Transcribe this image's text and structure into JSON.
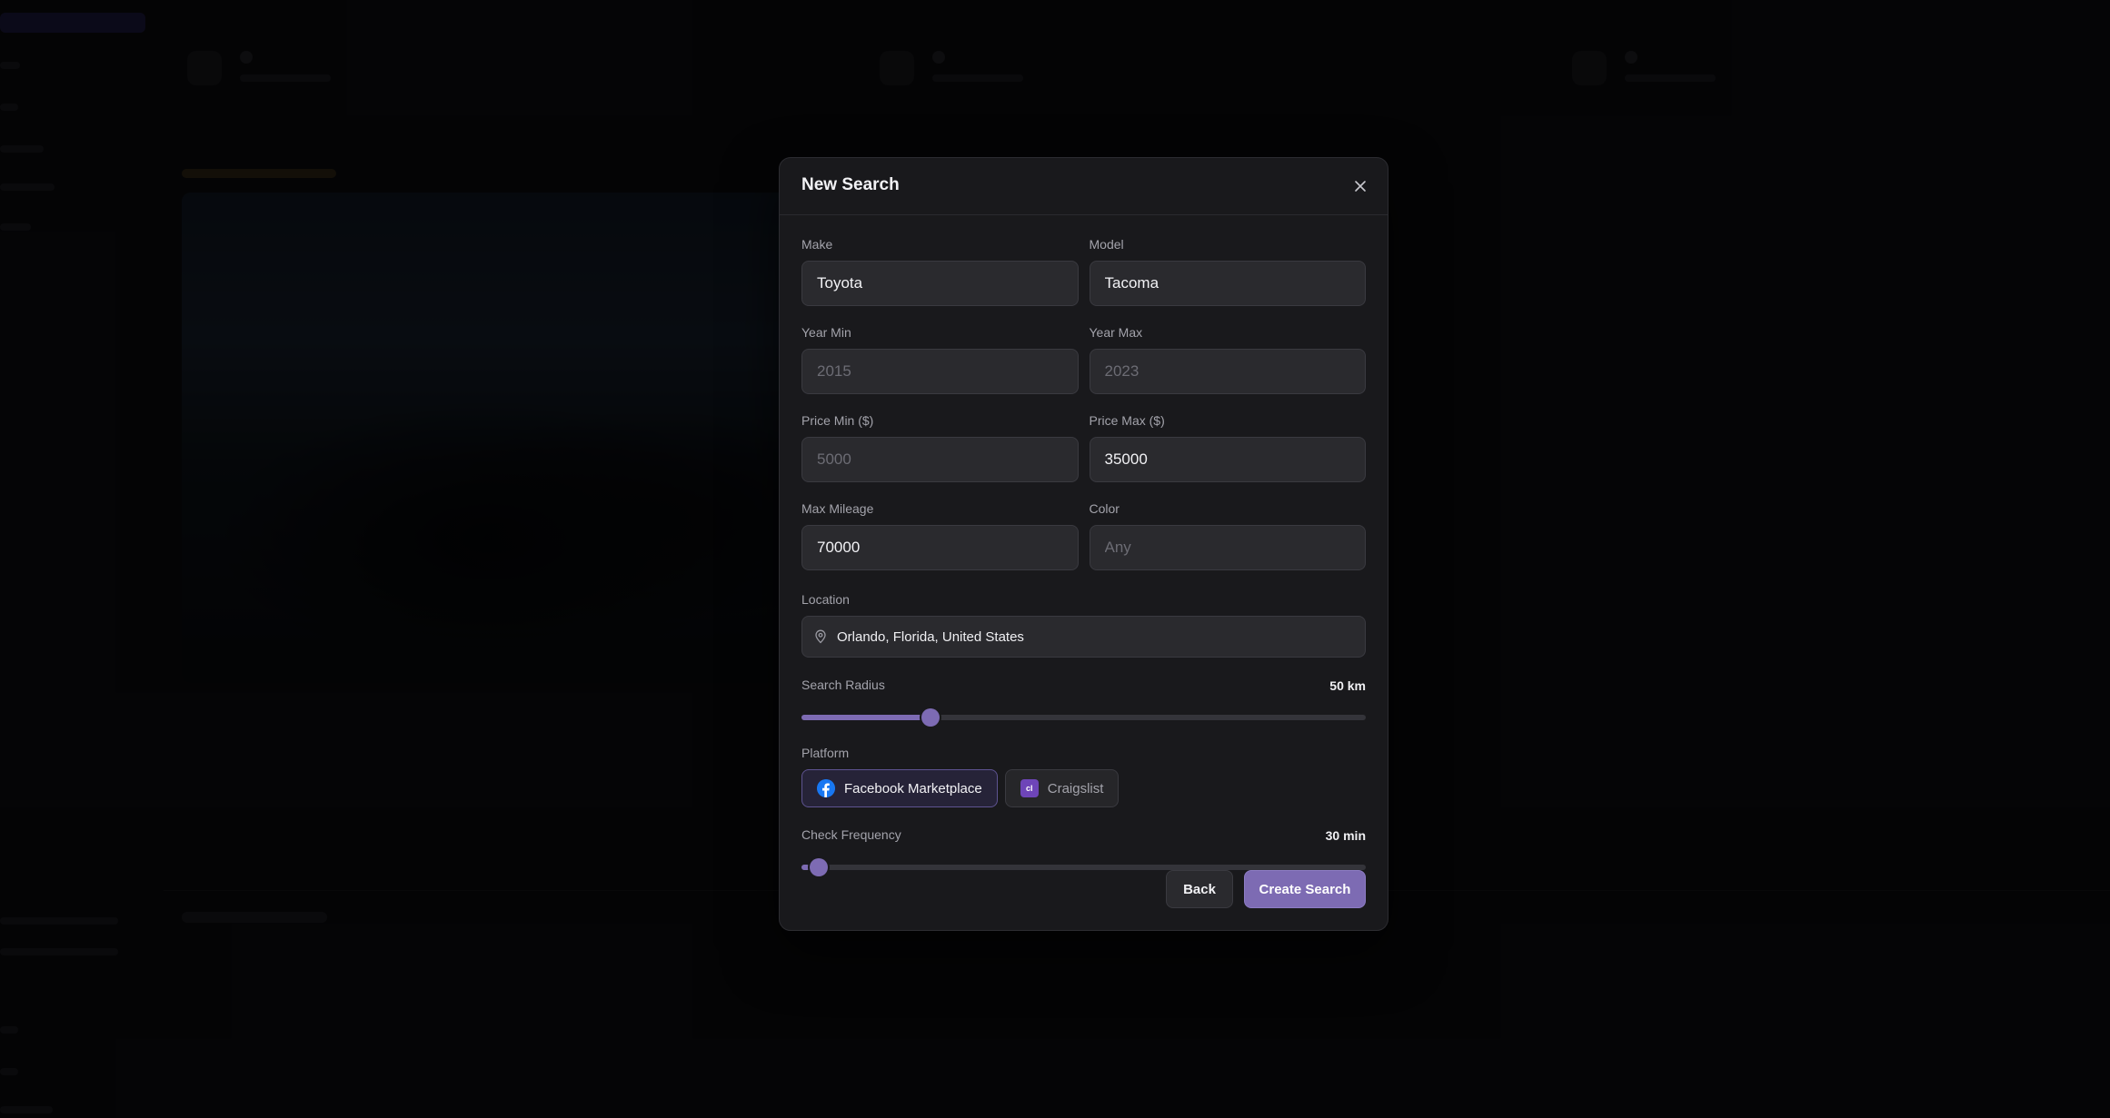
{
  "modal": {
    "title": "New Search",
    "close_icon": "close-icon",
    "fields": {
      "make": {
        "label": "Make",
        "value": "Toyota",
        "placeholder": ""
      },
      "model": {
        "label": "Model",
        "value": "Tacoma",
        "placeholder": ""
      },
      "year_min": {
        "label": "Year Min",
        "value": "",
        "placeholder": "2015"
      },
      "year_max": {
        "label": "Year Max",
        "value": "",
        "placeholder": "2023"
      },
      "price_min": {
        "label": "Price Min ($)",
        "value": "",
        "placeholder": "5000"
      },
      "price_max": {
        "label": "Price Max ($)",
        "value": "35000",
        "placeholder": ""
      },
      "max_mileage": {
        "label": "Max Mileage",
        "value": "70000",
        "placeholder": ""
      },
      "color": {
        "label": "Color",
        "value": "",
        "placeholder": "Any"
      }
    },
    "location": {
      "label": "Location",
      "value": "Orlando, Florida, United States",
      "icon": "map-pin-icon"
    },
    "search_radius": {
      "label": "Search Radius",
      "display": "50 km",
      "fraction": 0.22
    },
    "platform": {
      "label": "Platform",
      "options": [
        {
          "label": "Facebook Marketplace",
          "icon": "facebook-icon",
          "selected": true
        },
        {
          "label": "Craigslist",
          "icon": "craigslist-icon",
          "icon_text": "cl",
          "selected": false
        }
      ]
    },
    "check_frequency": {
      "label": "Check Frequency",
      "display": "30 min",
      "fraction": 0.015
    },
    "buttons": {
      "back": "Back",
      "create": "Create Search"
    }
  },
  "colors": {
    "accent": "#7d6bb3",
    "modal_bg": "#19191c",
    "input_bg": "#2a2a2e",
    "facebook": "#1877f2",
    "craigslist": "#6e45b8"
  }
}
